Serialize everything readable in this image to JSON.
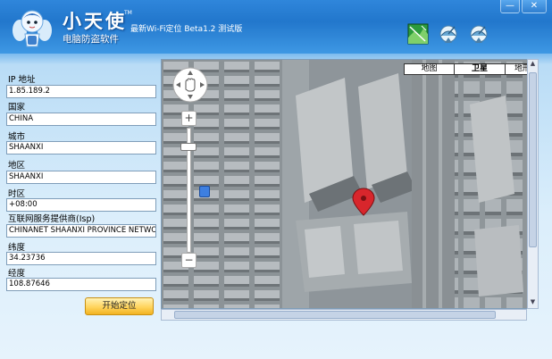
{
  "app": {
    "title": "小天使",
    "trademark": "TM",
    "subtitle": "电脑防盗软件",
    "version": "最新Wi-Fi定位 Beta1.2 测试版"
  },
  "window_buttons": {
    "minimize": "—",
    "close": "✕"
  },
  "fields": [
    {
      "label": "IP 地址",
      "value": "1.85.189.2"
    },
    {
      "label": "国家",
      "value": "CHINA"
    },
    {
      "label": "城市",
      "value": "SHAANXI"
    },
    {
      "label": "地区",
      "value": "SHAANXI"
    },
    {
      "label": "时区",
      "value": "+08:00"
    },
    {
      "label": "互联网服务提供商(Isp)",
      "value": "CHINANET SHAANXI PROVINCE NETWORK"
    },
    {
      "label": "纬度",
      "value": "34.23736"
    },
    {
      "label": "经度",
      "value": "108.87646"
    }
  ],
  "start_button": "开始定位",
  "map": {
    "tabs": [
      "地图",
      "卫星",
      "地形"
    ],
    "active_tab": "卫星",
    "zoom_in": "+",
    "zoom_out": "−"
  },
  "colors": {
    "titlebar": "#2277cc",
    "accent_button": "#ffd45c",
    "marker": "#d8262c"
  },
  "icons": [
    "map-tool-icon",
    "satellite-dish-icon",
    "satellite-dish-icon-2",
    "mascot-logo-icon"
  ]
}
